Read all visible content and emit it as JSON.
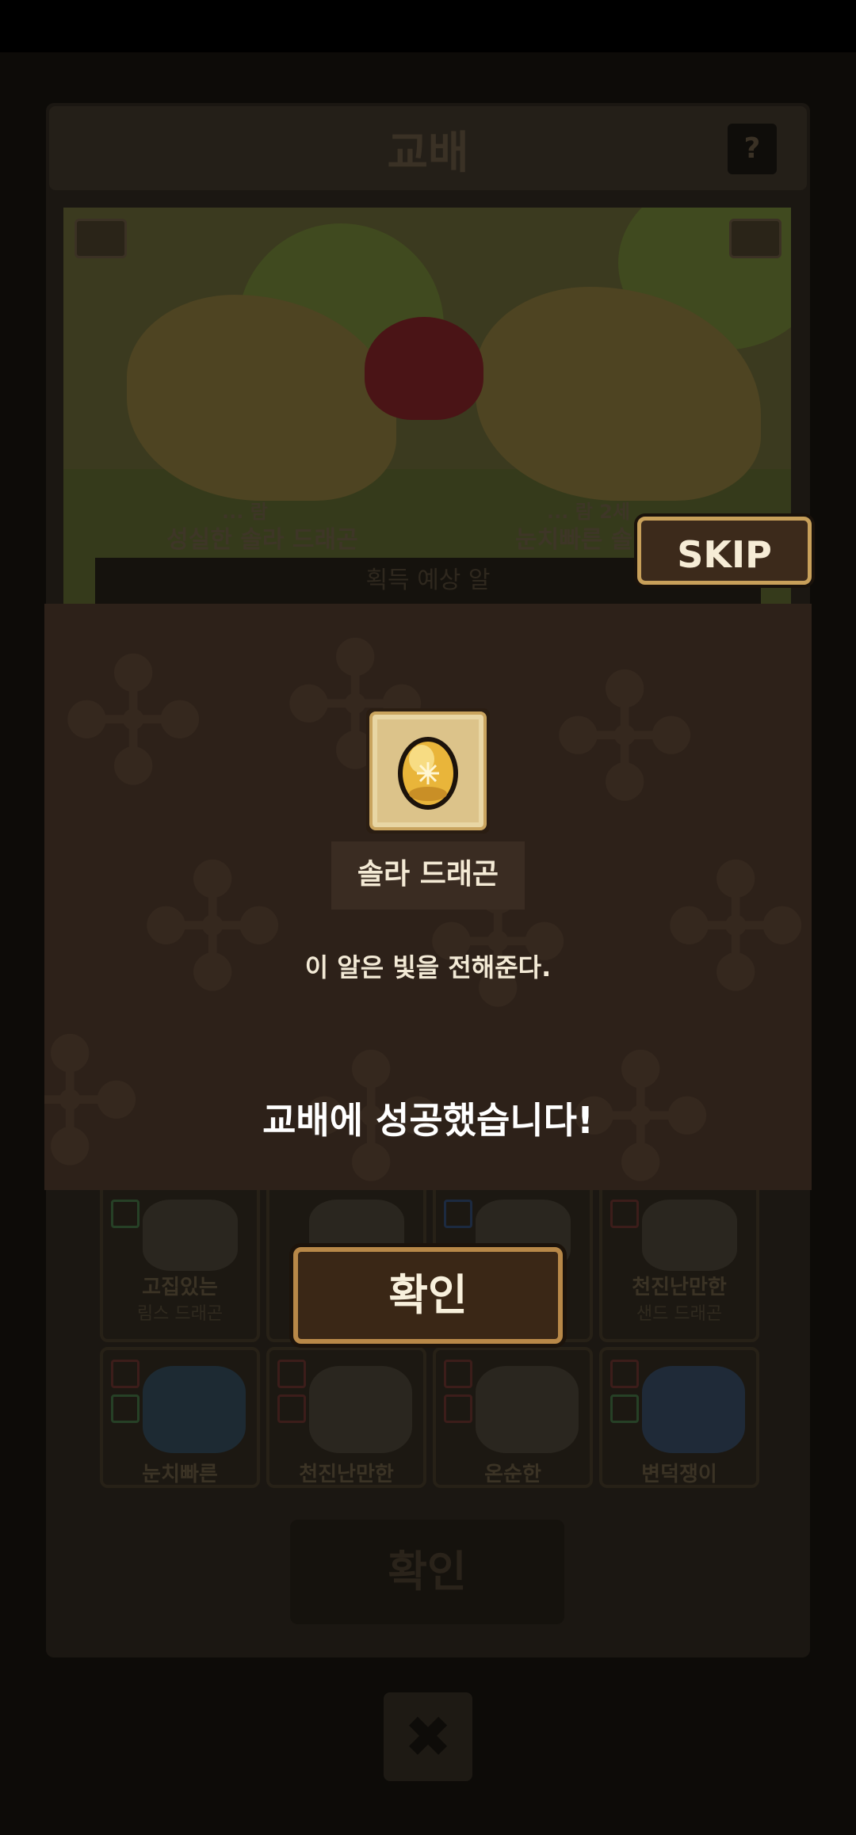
{
  "background": {
    "title": "교배",
    "help_label": "?",
    "parent_left": {
      "level": "Lv. 5?",
      "level_visible": "... 람",
      "name": "성실한 솔라 드래곤"
    },
    "parent_right": {
      "level_visible": "... 람 2세",
      "name": "눈치빠른 솔라"
    },
    "egg_bar_label": "획득 예상 알",
    "cards": [
      {
        "name": "고집있는",
        "sub": "림스 드래곤"
      },
      {
        "name": "",
        "sub": ""
      },
      {
        "name": "",
        "sub": ""
      },
      {
        "name": "천진난만한",
        "sub": "샌드 드래곤"
      },
      {
        "name": "눈치빠른",
        "sub": ""
      },
      {
        "name": "천진난만한",
        "sub": ""
      },
      {
        "name": "온순한",
        "sub": ""
      },
      {
        "name": "변덕쟁이",
        "sub": ""
      }
    ],
    "confirm_label": "확인",
    "close_label": "✖"
  },
  "popup": {
    "egg_icon": "golden-egg-icon",
    "egg_name": "솔라 드래곤",
    "egg_description": "이 알은 빛을 전해준다.",
    "success_message": "교배에 성공했습니다!",
    "confirm_label": "확인"
  },
  "skip_label": "SKIP",
  "colors": {
    "popup_bg": "#2d2119",
    "button_border": "#b88848",
    "egg_gold": "#e9b53a"
  }
}
